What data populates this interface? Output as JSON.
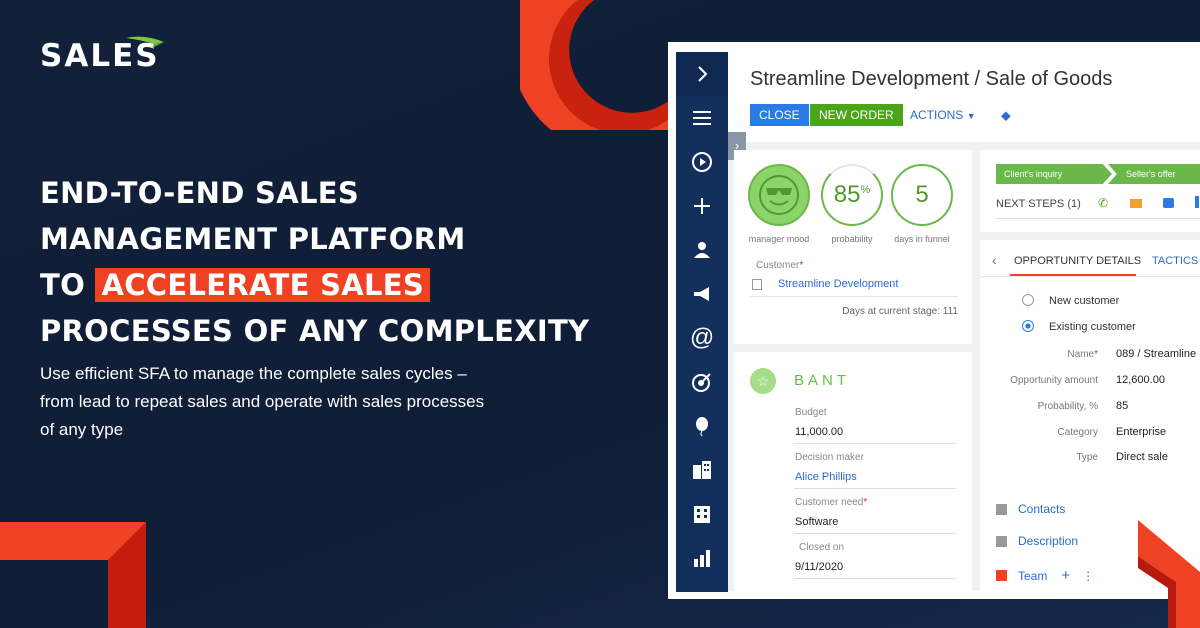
{
  "brand": {
    "logo_text": "SALES",
    "accent": "#ef4123",
    "navy": "#13305c"
  },
  "hero": {
    "line1": "END-TO-END SALES",
    "line2": "MANAGEMENT PLATFORM",
    "line3_prefix": "TO",
    "line3_highlight": "ACCELERATE SALES",
    "line4": "PROCESSES OF ANY COMPLEXITY",
    "subtitle_l1": "Use efficient SFA  to manage the complete sales cycles –",
    "subtitle_l2": "from lead to repeat sales and operate with sales processes",
    "subtitle_l3": "of any type"
  },
  "app": {
    "sidebar_icons": [
      "chevron-right-icon",
      "menu-icon",
      "play-icon",
      "plus-icon",
      "user-icon",
      "megaphone-icon",
      "at-icon",
      "target-icon",
      "balloon-icon",
      "buildings-icon",
      "building-icon",
      "chart-icon"
    ],
    "title": "Streamline Development / Sale of Goods",
    "toolbar": {
      "close": "CLOSE",
      "new_order": "NEW ORDER",
      "actions": "ACTIONS"
    },
    "metrics": {
      "mood_label": "manager mood",
      "probability_value": "85",
      "probability_unit": "%",
      "probability_label": "probability",
      "days_value": "5",
      "days_label": "days in funnel"
    },
    "customer": {
      "label": "Customer",
      "value": "Streamline Development",
      "days_at_stage": "Days at current stage: 111"
    },
    "stages": {
      "stage1": "Client's inquiry",
      "stage2": "Seller's offer",
      "next_steps": "NEXT STEPS (1)"
    },
    "bant": {
      "title": "BANT",
      "budget_label": "Budget",
      "budget_value": "11,000.00",
      "decision_label": "Decision maker",
      "decision_value": "Alice Phillips",
      "need_label": "Customer need",
      "need_value": "Software",
      "closed_label": "Closed on",
      "closed_value": "9/11/2020"
    },
    "tabs": {
      "details": "OPPORTUNITY DETAILS",
      "tactics": "TACTICS A"
    },
    "details": {
      "new_customer": "New customer",
      "existing_customer": "Existing customer",
      "name_label": "Name",
      "name_value": "089 / Streamline",
      "amount_label": "Opportunity amount",
      "amount_value": "12,600.00",
      "prob_label": "Probability, %",
      "prob_value": "85",
      "category_label": "Category",
      "category_value": "Enterprise",
      "type_label": "Type",
      "type_value": "Direct sale"
    },
    "sections": {
      "contacts": "Contacts",
      "description": "Description",
      "team": "Team"
    }
  }
}
